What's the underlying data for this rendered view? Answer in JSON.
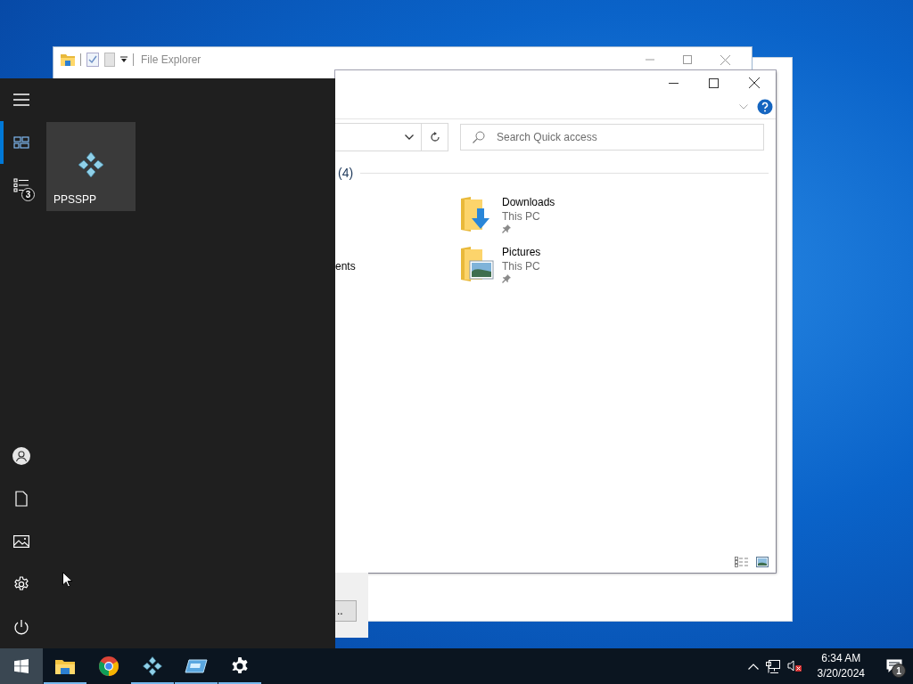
{
  "back_window": {
    "title": "File Explorer"
  },
  "explorer": {
    "search": {
      "placeholder": "Search Quick access"
    },
    "section_count": "(4)",
    "left_column": [
      "ents"
    ],
    "items": [
      {
        "name": "Downloads",
        "location": "This PC",
        "kind": "downloads",
        "pinned": true
      },
      {
        "name": "Pictures",
        "location": "This PC",
        "kind": "pictures",
        "pinned": true
      }
    ]
  },
  "dialog": {
    "button": ".."
  },
  "start_menu": {
    "rail_top": [
      {
        "kind": "menu",
        "selected": false
      },
      {
        "kind": "tiles",
        "selected": true
      },
      {
        "kind": "list",
        "selected": false,
        "badge": "3"
      }
    ],
    "rail_bottom": [
      {
        "kind": "user"
      },
      {
        "kind": "document"
      },
      {
        "kind": "pictures"
      },
      {
        "kind": "settings"
      },
      {
        "kind": "power"
      }
    ],
    "tiles": [
      {
        "label": "PPSSPP",
        "kind": "ppsspp"
      }
    ]
  },
  "taskbar": {
    "start_active": true,
    "apps": [
      {
        "kind": "explorer",
        "running": true
      },
      {
        "kind": "chrome",
        "running": false
      },
      {
        "kind": "ppsspp",
        "running": true
      },
      {
        "kind": "window",
        "running": true
      },
      {
        "kind": "settings",
        "running": true
      }
    ],
    "time": "6:34 AM",
    "date": "3/20/2024",
    "notification_count": "1"
  }
}
